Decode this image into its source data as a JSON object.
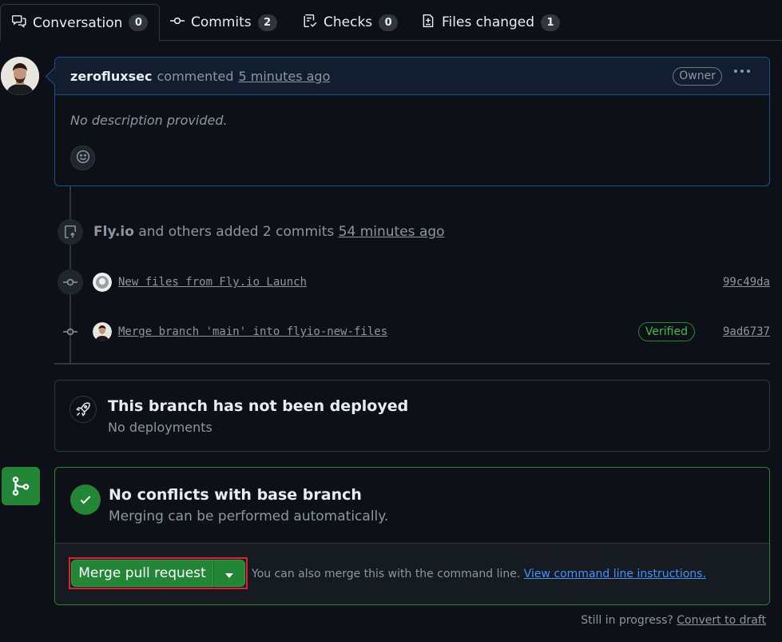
{
  "tabs": [
    {
      "label": "Conversation",
      "count": "0",
      "icon": "comment-discussion-icon"
    },
    {
      "label": "Commits",
      "count": "2",
      "icon": "git-commit-icon"
    },
    {
      "label": "Checks",
      "count": "0",
      "icon": "checklist-icon"
    },
    {
      "label": "Files changed",
      "count": "1",
      "icon": "file-diff-icon"
    }
  ],
  "comment": {
    "author": "zerofluxsec",
    "action": "commented",
    "time": "5 minutes ago",
    "role_badge": "Owner",
    "body": "No description provided."
  },
  "timeline": {
    "push_event": {
      "actor": "Fly.io",
      "text": "and others added 2 commits",
      "time": "54 minutes ago"
    },
    "commits": [
      {
        "message": "New files from Fly.io Launch",
        "sha": "99c49da",
        "verified": ""
      },
      {
        "message": "Merge branch 'main' into flyio-new-files",
        "sha": "9ad6737",
        "verified": "Verified"
      }
    ]
  },
  "deploy": {
    "title": "This branch has not been deployed",
    "subtitle": "No deployments"
  },
  "merge": {
    "title": "No conflicts with base branch",
    "subtitle": "Merging can be performed automatically.",
    "button_label": "Merge pull request",
    "note": "You can also merge this with the command line.",
    "link": "View command line instructions."
  },
  "footer": {
    "prefix": "Still in progress?",
    "link": "Convert to draft"
  },
  "colors": {
    "background": "#0d1117",
    "accent_green": "#238636",
    "link_blue": "#4493f8",
    "highlight_red": "#e5202e"
  }
}
